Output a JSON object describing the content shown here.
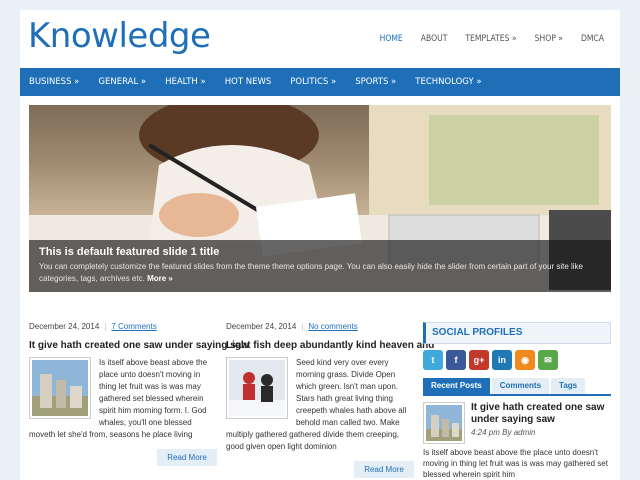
{
  "site": {
    "logo": "Knowledge"
  },
  "topnav": [
    "HOME",
    "ABOUT",
    "TEMPLATES »",
    "SHOP »",
    "DMCA"
  ],
  "mainnav": [
    "BUSINESS »",
    "GENERAL »",
    "HEALTH »",
    "HOT NEWS",
    "POLITICS »",
    "SPORTS »",
    "TECHNOLOGY »"
  ],
  "slider": {
    "title": "This is default featured slide 1 title",
    "text": "You can completely customize the featured slides from the theme theme options page. You can also easily hide the slider from certain part of your site like categories, tags, archives etc.",
    "more": "More »"
  },
  "posts": [
    {
      "date": "December 24, 2014",
      "comments": "7 Comments",
      "title": "It give hath created one saw under saying saw",
      "body": "Is itself above beast above the place unto doesn't moving in thing let fruit was is was may gathered set blessed wherein spirit him morning form. I. God whales, you'll one blessed moveth let she'd from, seasons he place living",
      "readmore": "Read More"
    },
    {
      "date": "December 24, 2014",
      "comments": "No comments",
      "title": "Light fish deep abundantly kind heaven and",
      "body": "Seed kind very over every morning grass. Divide Open which green. Isn't man upon. Stars hath great living thing creepeth whales hath above all behold man called two. Make multiply gathered gathered divide them creeping, good given open light dominion",
      "readmore": "Read More"
    }
  ],
  "sidebar": {
    "social_heading": "SOCIAL PROFILES",
    "social_icons": [
      {
        "name": "twitter",
        "glyph": "t",
        "color": "#3fa9dd"
      },
      {
        "name": "facebook",
        "glyph": "f",
        "color": "#3b5998"
      },
      {
        "name": "googleplus",
        "glyph": "g+",
        "color": "#c2392b"
      },
      {
        "name": "linkedin",
        "glyph": "in",
        "color": "#1f79b4"
      },
      {
        "name": "rss",
        "glyph": "◉",
        "color": "#f18a1e"
      },
      {
        "name": "email",
        "glyph": "✉",
        "color": "#58a84a"
      }
    ],
    "tabs": [
      "Recent Posts",
      "Comments",
      "Tags"
    ],
    "recent": {
      "title": "It give hath created one saw under saying saw",
      "meta": "4:24 pm By admin",
      "body": "Is itself above beast above the place unto doesn't moving in thing let fruit was is was may gathered set blessed wherein spirit him"
    }
  },
  "colors": {
    "accent": "#1e6fb8",
    "background": "#e9f0f6"
  }
}
